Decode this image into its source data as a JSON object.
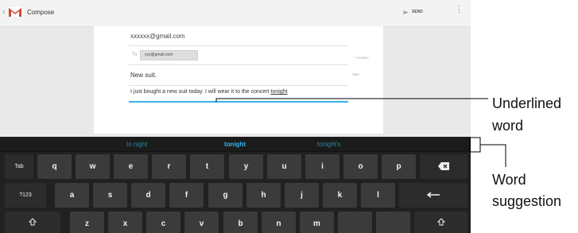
{
  "actionbar": {
    "title": "Compose",
    "send_label": "SEND",
    "brand_color": "#d14836"
  },
  "compose": {
    "from": "xxxxxx@gmail.com",
    "to_label": "To",
    "to_chip": "xyz@gmail.com",
    "cc_bcc_label": "+ CC/BCC",
    "attach_label": "GBD",
    "subject": "New suit.",
    "body_before": "I just bought a new suit today. I will wear it to the concert ",
    "body_underlined_word": "tonight",
    "accent_color": "#33b5e5"
  },
  "keyboard": {
    "suggestions": [
      "to night",
      "tonight",
      "tonight's"
    ],
    "row1": [
      "Tab",
      "q",
      "w",
      "e",
      "r",
      "t",
      "y",
      "u",
      "i",
      "o",
      "p",
      "backspace-icon"
    ],
    "row2": [
      "?123",
      "a",
      "s",
      "d",
      "f",
      "g",
      "h",
      "j",
      "k",
      "l",
      "enter-icon"
    ],
    "row3": [
      "shift-icon",
      "z",
      "x",
      "c",
      "v",
      "b",
      "n",
      "m",
      "shift-icon"
    ]
  },
  "callouts": {
    "underlined_word": "Underlined word",
    "word_suggestion": "Word suggestion"
  }
}
